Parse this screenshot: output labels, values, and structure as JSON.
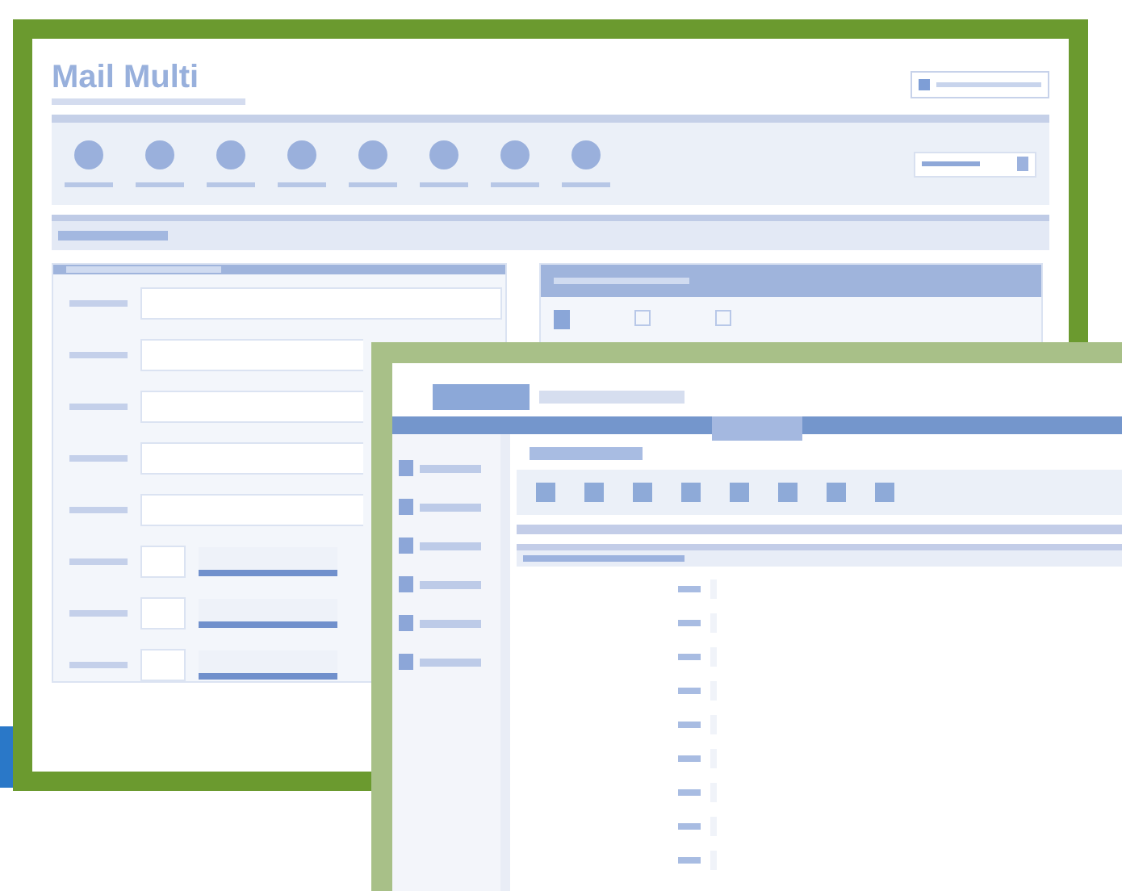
{
  "back_window": {
    "title": "Mail Multi"
  }
}
